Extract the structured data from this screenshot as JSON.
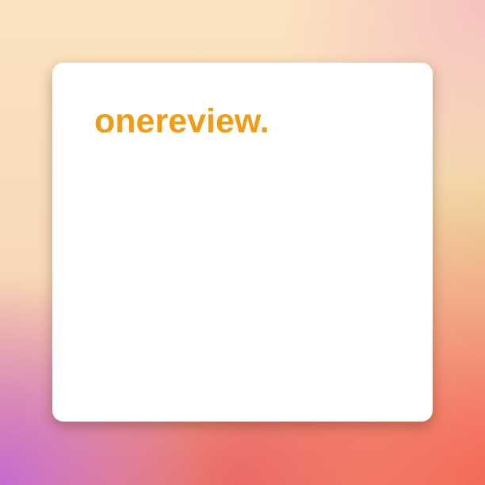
{
  "brand": {
    "logo_text": "onereview.",
    "color": "#f39c12"
  }
}
